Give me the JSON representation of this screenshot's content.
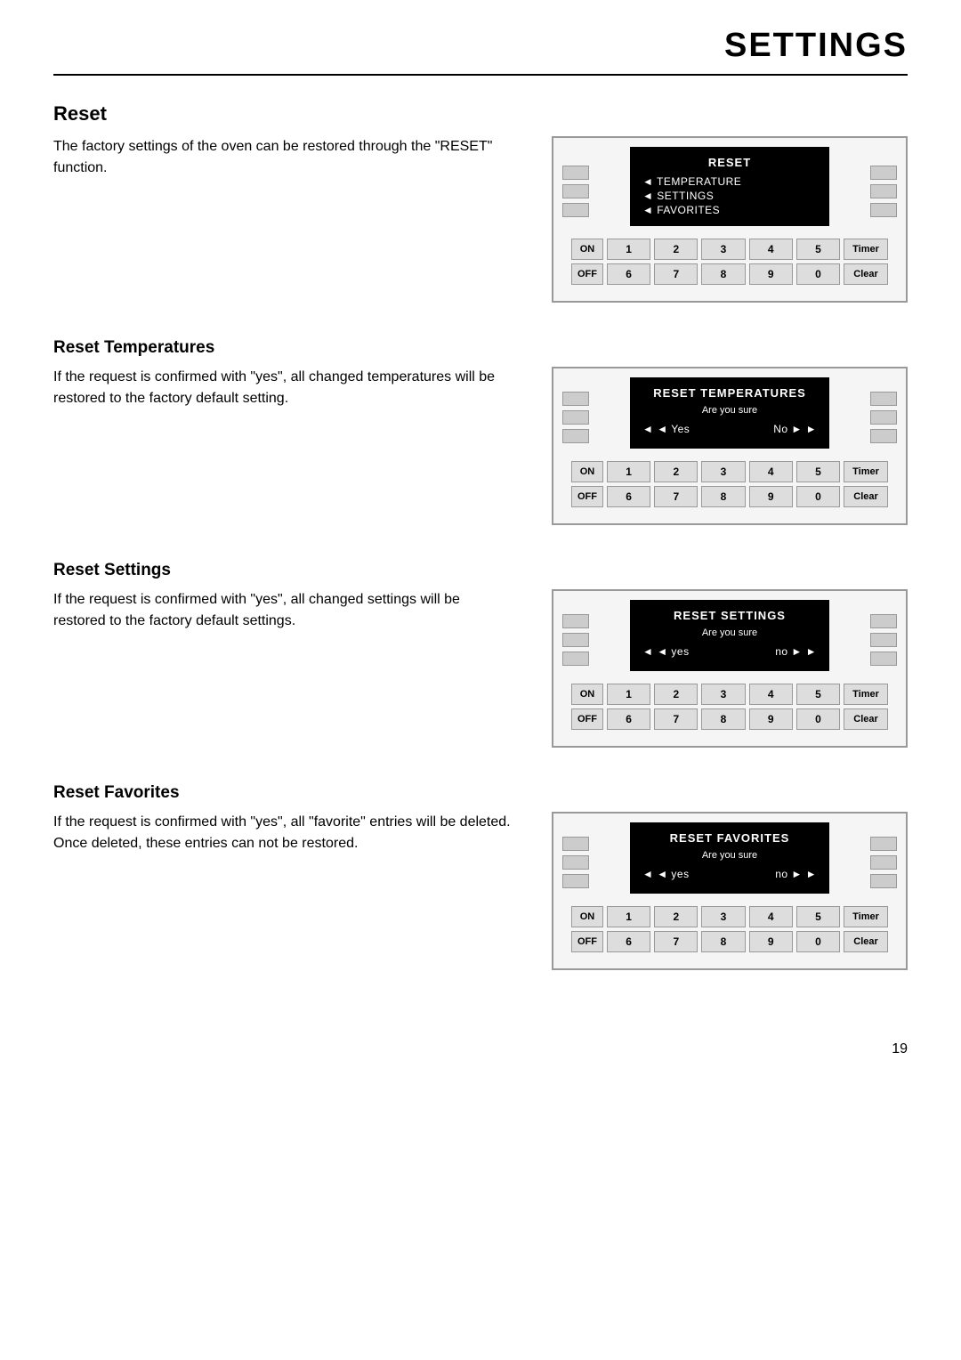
{
  "header": {
    "title": "SETTINGS",
    "page_number": "19"
  },
  "sections": [
    {
      "id": "reset",
      "title": "Reset",
      "text": "The factory settings of the oven can be restored through the \"RESET\" function.",
      "panel": {
        "display_title": "RESET",
        "menu_items": [
          "TEMPERATURE",
          "SETTINGS",
          "FAVORITES"
        ],
        "keypad_row1": [
          "ON",
          "1",
          "2",
          "3",
          "4",
          "5",
          "Timer"
        ],
        "keypad_row2": [
          "OFF",
          "6",
          "7",
          "8",
          "9",
          "0",
          "Clear"
        ]
      }
    },
    {
      "id": "reset-temperatures",
      "title": "Reset Temperatures",
      "text": "If the request is confirmed with \"yes\", all changed temperatures will be restored to the factory default setting.",
      "panel": {
        "display_title": "RESET TEMPERATURES",
        "display_subtitle": "Are you sure",
        "left_option": "Yes",
        "right_option": "No",
        "keypad_row1": [
          "ON",
          "1",
          "2",
          "3",
          "4",
          "5",
          "Timer"
        ],
        "keypad_row2": [
          "OFF",
          "6",
          "7",
          "8",
          "9",
          "0",
          "Clear"
        ]
      }
    },
    {
      "id": "reset-settings",
      "title": "Reset Settings",
      "text": "If the request is confirmed with \"yes\", all changed settings will be restored to the factory default settings.",
      "panel": {
        "display_title": "RESET SETTINGS",
        "display_subtitle": "Are you sure",
        "left_option": "yes",
        "right_option": "no",
        "keypad_row1": [
          "ON",
          "1",
          "2",
          "3",
          "4",
          "5",
          "Timer"
        ],
        "keypad_row2": [
          "OFF",
          "6",
          "7",
          "8",
          "9",
          "0",
          "Clear"
        ]
      }
    },
    {
      "id": "reset-favorites",
      "title": "Reset Favorites",
      "text": "If the request is confirmed with \"yes\", all \"favorite\" entries will be deleted. Once deleted, these entries can not be restored.",
      "panel": {
        "display_title": "RESET FAVORITES",
        "display_subtitle": "Are you sure",
        "left_option": "yes",
        "right_option": "no",
        "keypad_row1": [
          "ON",
          "1",
          "2",
          "3",
          "4",
          "5",
          "Timer"
        ],
        "keypad_row2": [
          "OFF",
          "6",
          "7",
          "8",
          "9",
          "0",
          "Clear"
        ]
      }
    }
  ],
  "buttons": {
    "timer": "Timer",
    "clear": "Clear",
    "on": "ON",
    "off": "OFF"
  }
}
